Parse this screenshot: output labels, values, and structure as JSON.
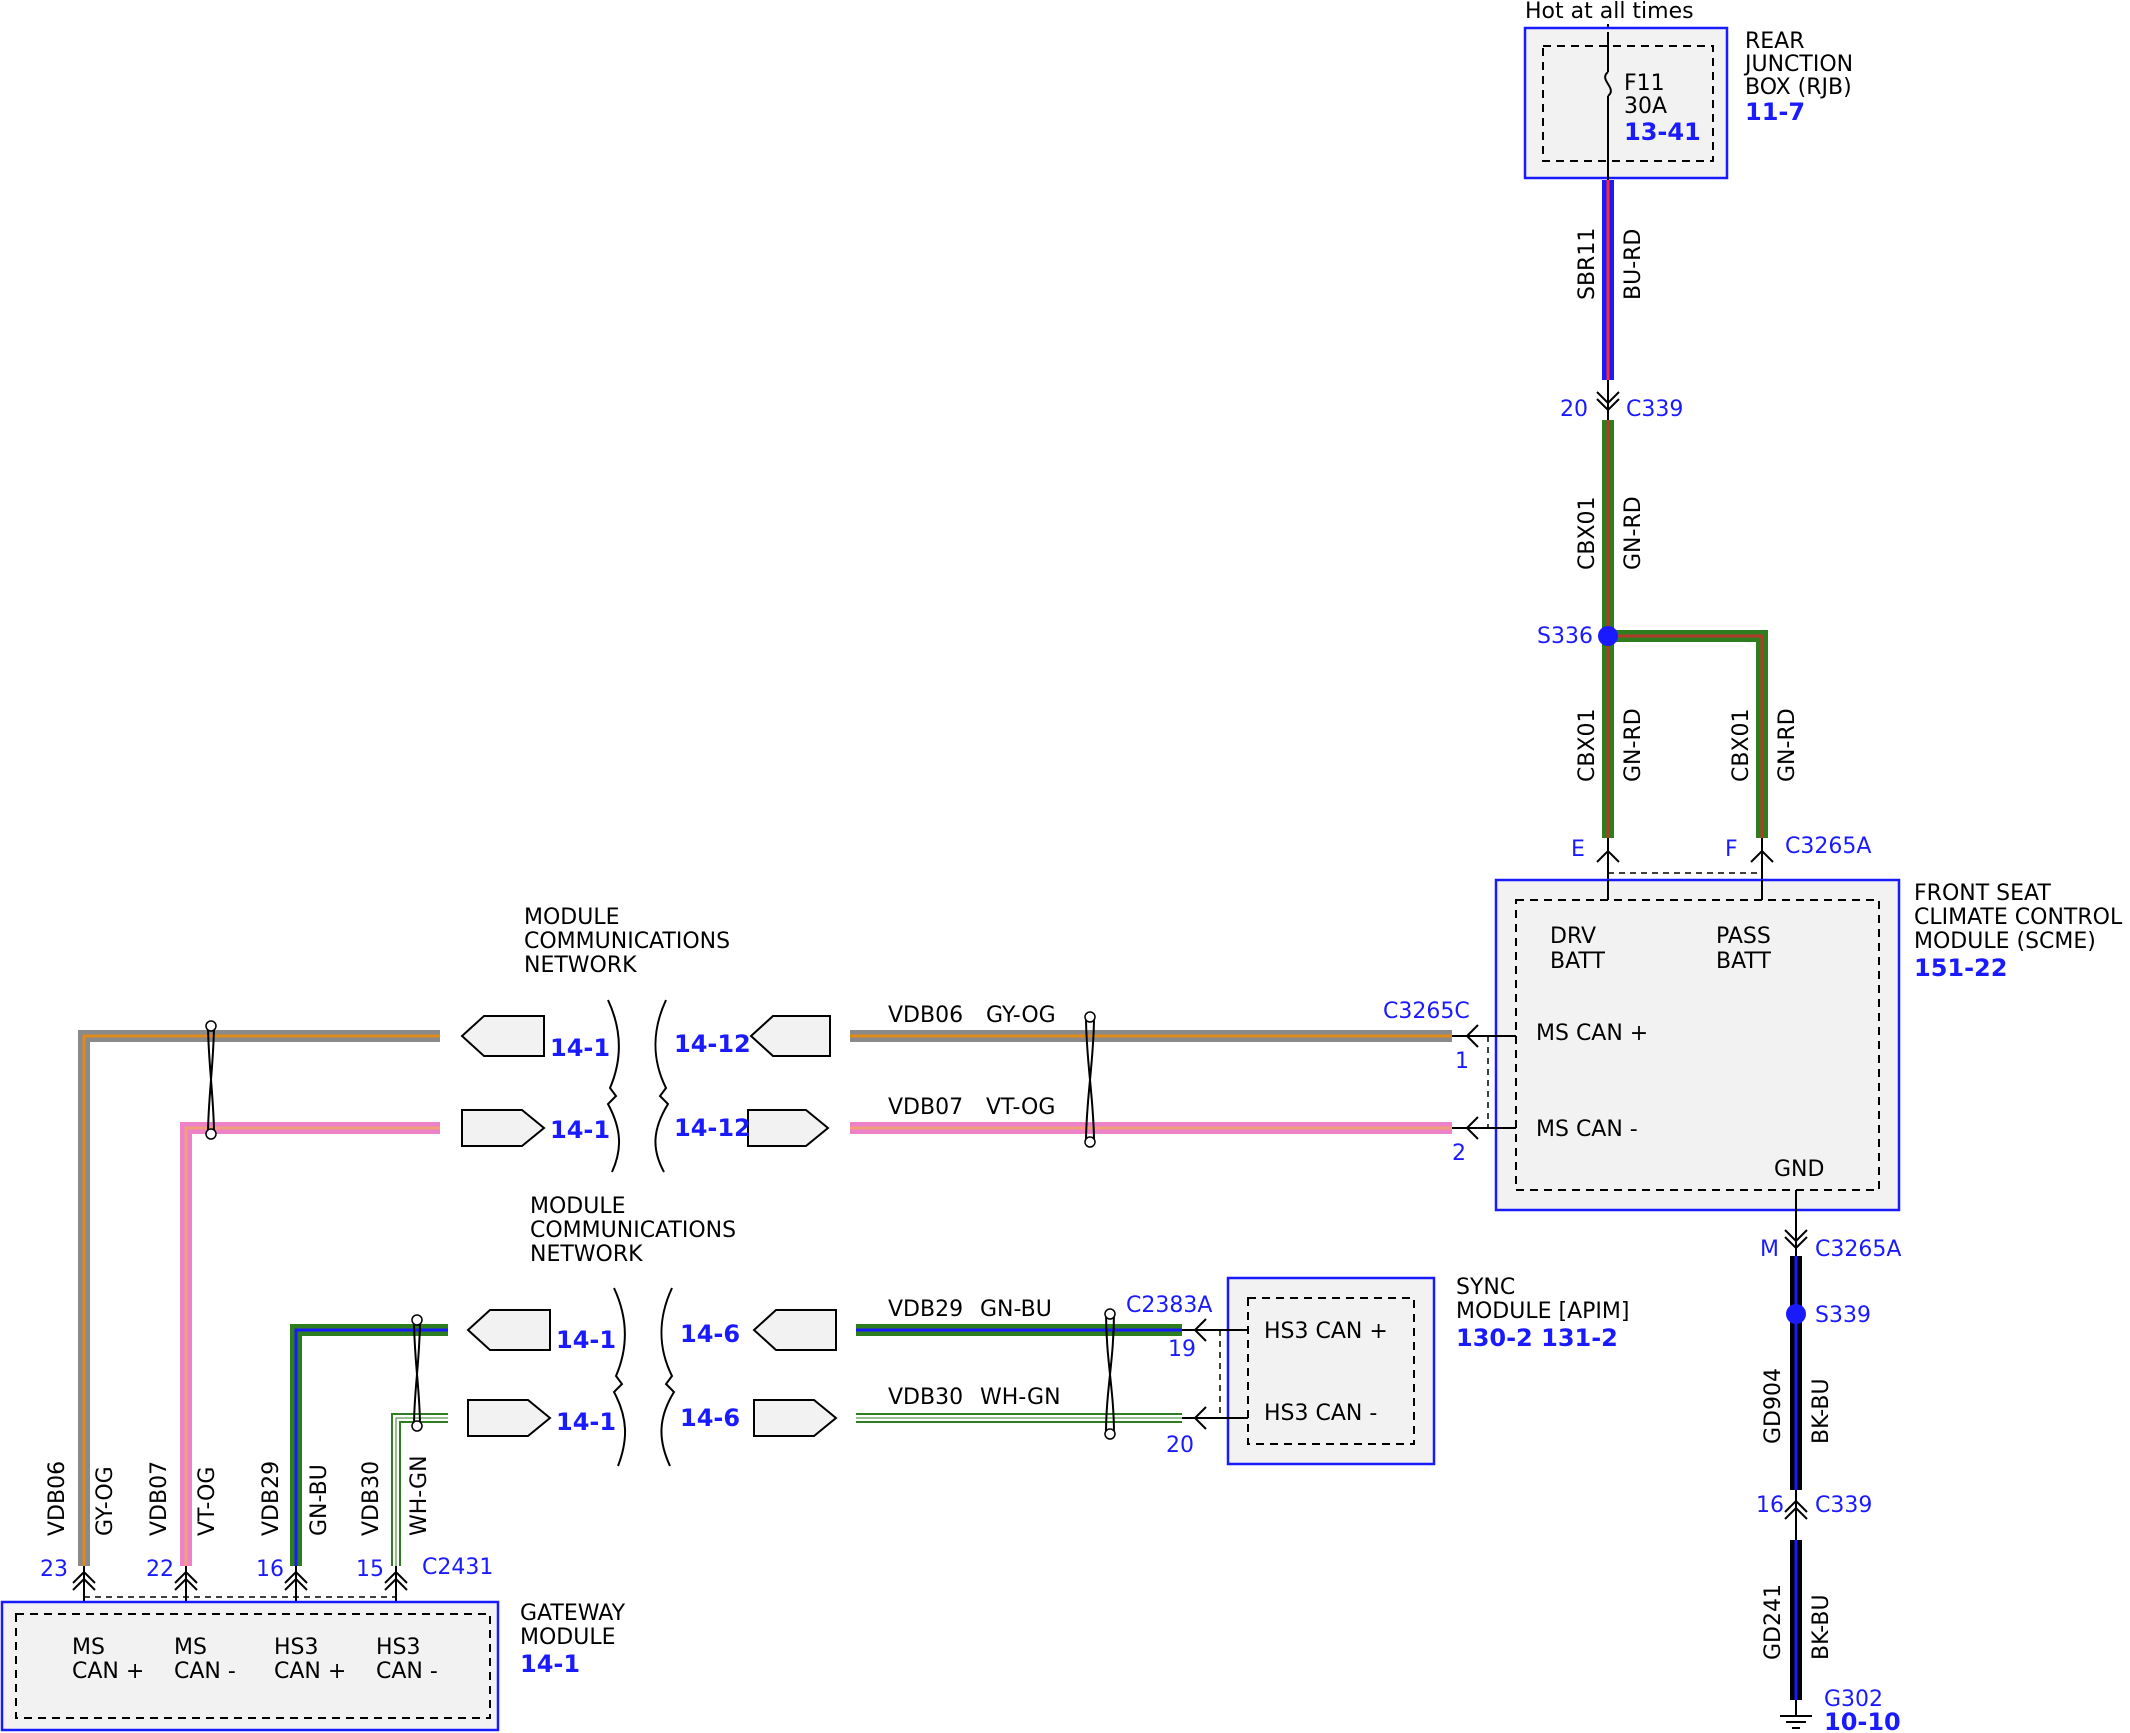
{
  "colors": {
    "accent_blue": "#1a1aff",
    "BU-RD": [
      "#1a1aff",
      "#ff2a2a"
    ],
    "GN-RD": [
      "#2e7d1f",
      "#b23a2a"
    ],
    "GY-OG": [
      "#8a8a8a",
      "#e08a1a"
    ],
    "VT-OG": [
      "#ee82c8",
      "#f2a07a"
    ],
    "GN-BU": [
      "#2e7d1f",
      "#1a1aff"
    ],
    "WH-GN": [
      "#ffffff",
      "#2e7d1f"
    ],
    "BK-BU": [
      "#000000",
      "#1a1aff"
    ]
  },
  "power": {
    "hot_label": "Hot at all times"
  },
  "rjb": {
    "name": [
      "REAR",
      "JUNCTION",
      "BOX (RJB)"
    ],
    "ref": "11-7",
    "fuse": {
      "id": "F11",
      "rating": "30A",
      "ref": "13-41"
    }
  },
  "scme": {
    "name": [
      "FRONT SEAT",
      "CLIMATE CONTROL",
      "MODULE (SCME)"
    ],
    "ref": "151-22",
    "pins": {
      "drv_batt": [
        "DRV",
        "BATT"
      ],
      "pass_batt": [
        "PASS",
        "BATT"
      ],
      "ms_can_plus": "MS CAN +",
      "ms_can_minus": "MS CAN -",
      "gnd": "GND"
    }
  },
  "sync": {
    "name": [
      "SYNC",
      "MODULE [APIM]"
    ],
    "ref": "130-2 131-2",
    "pins": {
      "hs3_can_plus": "HS3 CAN +",
      "hs3_can_minus": "HS3 CAN -"
    }
  },
  "gateway": {
    "name": [
      "GATEWAY",
      "MODULE"
    ],
    "ref": "14-1",
    "pins": [
      [
        "MS",
        "CAN +"
      ],
      [
        "MS",
        "CAN -"
      ],
      [
        "HS3",
        "CAN +"
      ],
      [
        "HS3",
        "CAN -"
      ]
    ]
  },
  "network_label": [
    "MODULE",
    "COMMUNICATIONS",
    "NETWORK"
  ],
  "wires": {
    "sbr11": {
      "circuit": "SBR11",
      "color": "BU-RD"
    },
    "cbx01_top": {
      "circuit": "CBX01",
      "color": "GN-RD"
    },
    "cbx01_e": {
      "circuit": "CBX01",
      "color": "GN-RD"
    },
    "cbx01_f": {
      "circuit": "CBX01",
      "color": "GN-RD"
    },
    "vdb06": {
      "circuit": "VDB06",
      "color": "GY-OG"
    },
    "vdb07": {
      "circuit": "VDB07",
      "color": "VT-OG"
    },
    "vdb29": {
      "circuit": "VDB29",
      "color": "GN-BU"
    },
    "vdb30": {
      "circuit": "VDB30",
      "color": "WH-GN"
    },
    "gd904": {
      "circuit": "GD904",
      "color": "BK-BU"
    },
    "gd241": {
      "circuit": "GD241",
      "color": "BK-BU"
    }
  },
  "connectors": {
    "c339": "C339",
    "c339_pin_top": "20",
    "c339_pin_bottom": "16",
    "c3265a": "C3265A",
    "c3265a_pin_e": "E",
    "c3265a_pin_f": "F",
    "c3265a_pin_m": "M",
    "c3265c": "C3265C",
    "c3265c_pin1": "1",
    "c3265c_pin2": "2",
    "c2383a": "C2383A",
    "c2383a_pin19": "19",
    "c2383a_pin20": "20",
    "c2431": "C2431",
    "c2431_pins": [
      "23",
      "22",
      "16",
      "15"
    ]
  },
  "splices": {
    "s336": "S336",
    "s339": "S339"
  },
  "ground": {
    "id": "G302",
    "ref": "10-10"
  },
  "page_refs": {
    "ms_plus_left": "14-1",
    "ms_plus_right": "14-12",
    "ms_minus_left": "14-1",
    "ms_minus_right": "14-12",
    "hs3_plus_left": "14-1",
    "hs3_plus_right": "14-6",
    "hs3_minus_left": "14-1",
    "hs3_minus_right": "14-6"
  }
}
